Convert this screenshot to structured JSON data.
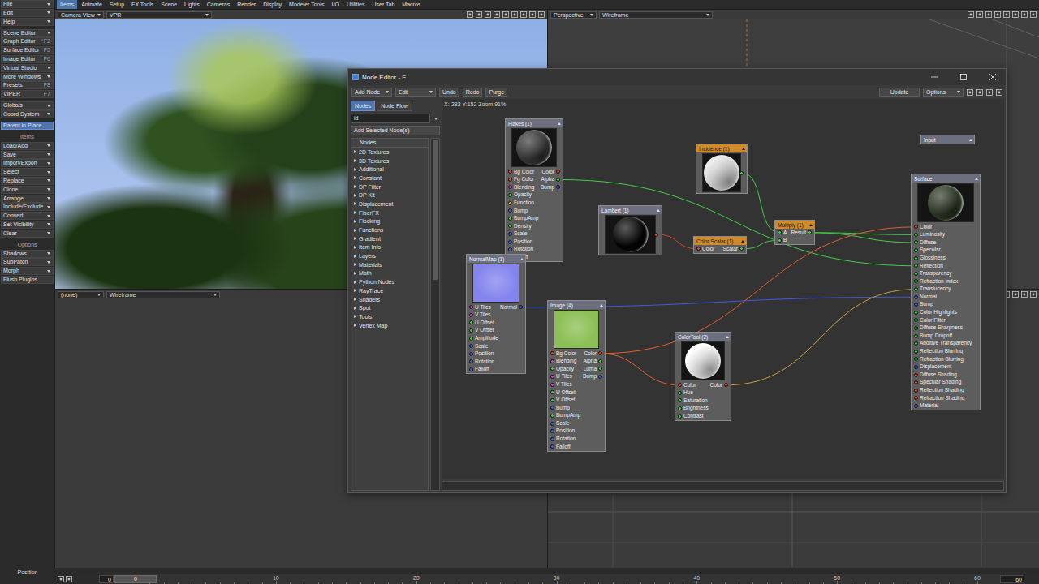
{
  "menu_tabs": [
    {
      "label": "Items",
      "selected": true
    },
    {
      "label": "Animate",
      "selected": false
    },
    {
      "label": "Setup",
      "selected": false
    },
    {
      "label": "FX Tools",
      "selected": false
    },
    {
      "label": "Scene",
      "selected": false
    },
    {
      "label": "Lights",
      "selected": false
    },
    {
      "label": "Cameras",
      "selected": false
    },
    {
      "label": "Render",
      "selected": false
    },
    {
      "label": "Display",
      "selected": false
    },
    {
      "label": "Modeler Tools",
      "selected": false
    },
    {
      "label": "I/O",
      "selected": false
    },
    {
      "label": "Utilities",
      "selected": false
    },
    {
      "label": "User Tab",
      "selected": false
    },
    {
      "label": "Macros",
      "selected": false
    }
  ],
  "sidebar": {
    "groups": [
      {
        "items": [
          {
            "label": "File",
            "dropdown": true
          },
          {
            "label": "Edit",
            "dropdown": true
          },
          {
            "label": "Help",
            "dropdown": true
          }
        ]
      },
      {
        "items": [
          {
            "label": "Scene Editor",
            "dropdown": true
          },
          {
            "label": "Graph Editor",
            "dropdown": false,
            "shortcut": "^F2"
          },
          {
            "label": "Surface Editor",
            "dropdown": false,
            "shortcut": "F5"
          },
          {
            "label": "Image Editor",
            "dropdown": false,
            "shortcut": "F6"
          },
          {
            "label": "Virtual Studio",
            "dropdown": true
          },
          {
            "label": "More Windows",
            "dropdown": true
          },
          {
            "label": "Presets",
            "dropdown": false,
            "shortcut": "F8"
          },
          {
            "label": "VIPER",
            "dropdown": false,
            "shortcut": "F7"
          }
        ]
      },
      {
        "items": [
          {
            "label": "Globals",
            "dropdown": true
          },
          {
            "label": "Coord System",
            "dropdown": true
          }
        ]
      },
      {
        "items": [
          {
            "label": "Parent in Place",
            "dropdown": false,
            "on": true
          }
        ]
      },
      {
        "header": "Items",
        "items": [
          {
            "label": "Load/Add",
            "dropdown": true
          },
          {
            "label": "Save",
            "dropdown": true
          },
          {
            "label": "Import/Export",
            "dropdown": true
          },
          {
            "label": "Select",
            "dropdown": true
          },
          {
            "label": "Replace",
            "dropdown": true
          },
          {
            "label": "Clone",
            "dropdown": true
          },
          {
            "label": "Arrange",
            "dropdown": true
          },
          {
            "label": "Include/Exclude",
            "dropdown": true
          },
          {
            "label": "Convert",
            "dropdown": true
          },
          {
            "label": "Set Visibility",
            "dropdown": true
          },
          {
            "label": "Clear",
            "dropdown": true
          }
        ]
      },
      {
        "header": "Options",
        "items": [
          {
            "label": "Shadows",
            "dropdown": true
          },
          {
            "label": "SubPatch",
            "dropdown": true
          },
          {
            "label": "Morph",
            "dropdown": true
          },
          {
            "label": "Flush Plugins",
            "dropdown": false
          }
        ]
      }
    ]
  },
  "viewports": [
    {
      "kind": "render",
      "view": "Camera View",
      "mode": "VPR"
    },
    {
      "kind": "grid",
      "view": "Perspective",
      "mode": "Wireframe"
    },
    {
      "kind": "empty",
      "view": "(none)",
      "mode": "Wireframe"
    },
    {
      "kind": "floor"
    }
  ],
  "timeline": {
    "label": "Position",
    "start": "0",
    "current": "0",
    "ticks": [
      "10",
      "20",
      "30",
      "40",
      "50",
      "60"
    ],
    "end": "60"
  },
  "node_editor": {
    "title": "Node Editor - F",
    "toolbar_left": [
      {
        "label": "Add Node",
        "dropdown": true
      },
      {
        "label": "Edit",
        "dropdown": true
      },
      {
        "label": "Undo",
        "dropdown": false
      },
      {
        "label": "Redo",
        "dropdown": false
      },
      {
        "label": "Purge",
        "dropdown": false
      }
    ],
    "toolbar_right": [
      {
        "label": "Update",
        "dropdown": false
      },
      {
        "label": "Options",
        "dropdown": true
      }
    ],
    "panel_tabs": [
      {
        "label": "Nodes",
        "selected": true
      },
      {
        "label": "Node Flow",
        "selected": false
      }
    ],
    "search": {
      "value": "id"
    },
    "add_button": "Add Selected Node(s)",
    "list_header": "Nodes",
    "categories": [
      {
        "label": "2D Textures",
        "expanded": false
      },
      {
        "label": "3D Textures",
        "expanded": false
      },
      {
        "label": "Additional",
        "expanded": false
      },
      {
        "label": "Constant",
        "expanded": false
      },
      {
        "label": "DP Filter",
        "expanded": false
      },
      {
        "label": "DP Kit",
        "expanded": false
      },
      {
        "label": "Displacement",
        "expanded": false
      },
      {
        "label": "FiberFX",
        "expanded": false
      },
      {
        "label": "Flocking",
        "expanded": false
      },
      {
        "label": "Functions",
        "expanded": false
      },
      {
        "label": "Gradient",
        "expanded": false
      },
      {
        "label": "Item Info",
        "expanded": false
      },
      {
        "label": "Layers",
        "expanded": false
      },
      {
        "label": "Materials",
        "expanded": false
      },
      {
        "label": "Math",
        "expanded": false
      },
      {
        "label": "Python Nodes",
        "expanded": false
      },
      {
        "label": "RayTrace",
        "expanded": false
      },
      {
        "label": "Shaders",
        "expanded": false
      },
      {
        "label": "Spot",
        "expanded": false
      },
      {
        "label": "Tools",
        "expanded": false
      },
      {
        "label": "Vertex Map",
        "expanded": false
      }
    ],
    "status": "X:-282 Y:152 Zoom:91%",
    "nodes": [
      {
        "title": "Flakes (1)",
        "selected": false,
        "preview": {
          "shape": "sphere",
          "color": "#3a3a3a"
        },
        "inputs": [
          {
            "label": "Bg Color",
            "color": "#e0482a"
          },
          {
            "label": "Fg Color",
            "color": "#e0482a"
          },
          {
            "label": "Blending",
            "color": "#c84ac8"
          },
          {
            "label": "Opacity",
            "color": "#3fcf45"
          },
          {
            "label": "Function",
            "color": "#d8c030"
          },
          {
            "label": "Bump",
            "color": "#4060e0"
          },
          {
            "label": "BumpAmp",
            "color": "#3fcf45"
          },
          {
            "label": "Density",
            "color": "#3fcf45"
          },
          {
            "label": "Scale",
            "color": "#4060e0"
          },
          {
            "label": "Position",
            "color": "#4060e0"
          },
          {
            "label": "Rotation",
            "color": "#4060e0"
          },
          {
            "label": "Falloff",
            "color": "#4060e0"
          }
        ],
        "outputs": [
          {
            "label": "Color",
            "color": "#e0482a"
          },
          {
            "label": "Alpha",
            "color": "#3fcf45"
          },
          {
            "label": "Bump",
            "color": "#4060e0"
          }
        ]
      },
      {
        "title": "Incidence (1)",
        "selected": true,
        "preview": {
          "shape": "sphere",
          "color": "#e6e6e6"
        },
        "inputs": [],
        "outputs": [],
        "out_pin": "#3fcf45"
      },
      {
        "title": "Lambert (1)",
        "selected": false,
        "preview": {
          "shape": "sphere",
          "color": "#050505"
        },
        "inputs": [],
        "outputs": [],
        "out_pin": "#e0482a"
      },
      {
        "title": "Color Scalar (1)",
        "selected": true,
        "inputs": [
          {
            "label": "Color",
            "color": "#e0482a"
          }
        ],
        "outputs": [
          {
            "label": "Scalar",
            "color": "#3fcf45"
          }
        ]
      },
      {
        "title": "Multiply (1)",
        "selected": true,
        "inputs": [
          {
            "label": "A",
            "color": "#3fcf45"
          },
          {
            "label": "B",
            "color": "#3fcf45"
          }
        ],
        "outputs": [
          {
            "label": "Result",
            "color": "#3fcf45"
          }
        ]
      },
      {
        "title": "NormalMap (1)",
        "selected": false,
        "preview": {
          "shape": "square",
          "color": "#8484ee"
        },
        "inputs": [
          {
            "label": "U Tiles",
            "color": "#c84ac8"
          },
          {
            "label": "V Tiles",
            "color": "#c84ac8"
          },
          {
            "label": "U Offset",
            "color": "#3fcf45"
          },
          {
            "label": "V Offset",
            "color": "#3fcf45"
          },
          {
            "label": "Amplitude",
            "color": "#3fcf45"
          },
          {
            "label": "Scale",
            "color": "#4060e0"
          },
          {
            "label": "Position",
            "color": "#4060e0"
          },
          {
            "label": "Rotation",
            "color": "#4060e0"
          },
          {
            "label": "Falloff",
            "color": "#4060e0"
          }
        ],
        "outputs": [
          {
            "label": "Normal",
            "color": "#4060e0"
          }
        ]
      },
      {
        "title": "Image (4)",
        "selected": false,
        "preview": {
          "shape": "square",
          "color": "#8cbf55"
        },
        "inputs": [
          {
            "label": "Bg Color",
            "color": "#e0482a"
          },
          {
            "label": "Blending",
            "color": "#c84ac8"
          },
          {
            "label": "Opacity",
            "color": "#3fcf45"
          },
          {
            "label": "U Tiles",
            "color": "#c84ac8"
          },
          {
            "label": "V Tiles",
            "color": "#c84ac8"
          },
          {
            "label": "U Offset",
            "color": "#3fcf45"
          },
          {
            "label": "V Offset",
            "color": "#3fcf45"
          },
          {
            "label": "Bump",
            "color": "#4060e0"
          },
          {
            "label": "BumpAmp",
            "color": "#3fcf45"
          },
          {
            "label": "Scale",
            "color": "#4060e0"
          },
          {
            "label": "Position",
            "color": "#4060e0"
          },
          {
            "label": "Rotation",
            "color": "#4060e0"
          },
          {
            "label": "Falloff",
            "color": "#4060e0"
          }
        ],
        "outputs": [
          {
            "label": "Color",
            "color": "#e0482a"
          },
          {
            "label": "Alpha",
            "color": "#3fcf45"
          },
          {
            "label": "Luma",
            "color": "#3fcf45"
          },
          {
            "label": "Bump",
            "color": "#4060e0"
          }
        ]
      },
      {
        "title": "ColorTool (2)",
        "selected": false,
        "preview": {
          "shape": "sphere",
          "color": "#ffffff"
        },
        "inputs": [
          {
            "label": "Color",
            "color": "#e0482a"
          },
          {
            "label": "Hue",
            "color": "#3fcf45"
          },
          {
            "label": "Saturation",
            "color": "#3fcf45"
          },
          {
            "label": "Brightness",
            "color": "#3fcf45"
          },
          {
            "label": "Contrast",
            "color": "#3fcf45"
          }
        ],
        "outputs": [
          {
            "label": "Color",
            "color": "#e0482a"
          }
        ]
      },
      {
        "title": "Surface",
        "selected": false,
        "preview": {
          "shape": "sphere",
          "color": "#2e3b26"
        },
        "inputs": [
          {
            "label": "Color",
            "color": "#e0482a"
          },
          {
            "label": "Luminosity",
            "color": "#3fcf45"
          },
          {
            "label": "Diffuse",
            "color": "#3fcf45"
          },
          {
            "label": "Specular",
            "color": "#3fcf45"
          },
          {
            "label": "Glossiness",
            "color": "#3fcf45"
          },
          {
            "label": "Reflection",
            "color": "#3fcf45"
          },
          {
            "label": "Transparency",
            "color": "#3fcf45"
          },
          {
            "label": "Refraction Index",
            "color": "#3fcf45"
          },
          {
            "label": "Translucency",
            "color": "#3fcf45"
          },
          {
            "label": "Normal",
            "color": "#4060e0"
          },
          {
            "label": "Bump",
            "color": "#4060e0"
          },
          {
            "label": "Color Highlights",
            "color": "#3fcf45"
          },
          {
            "label": "Color Filter",
            "color": "#3fcf45"
          },
          {
            "label": "Diffuse Sharpness",
            "color": "#3fcf45"
          },
          {
            "label": "Bump Dropoff",
            "color": "#3fcf45"
          },
          {
            "label": "Additive Transparency",
            "color": "#3fcf45"
          },
          {
            "label": "Reflection Blurring",
            "color": "#3fcf45"
          },
          {
            "label": "Refraction Blurring",
            "color": "#3fcf45"
          },
          {
            "label": "Displacement",
            "color": "#4060e0"
          },
          {
            "label": "Diffuse Shading",
            "color": "#e0482a"
          },
          {
            "label": "Specular Shading",
            "color": "#e0482a"
          },
          {
            "label": "Reflection Shading",
            "color": "#e0482a"
          },
          {
            "label": "Refraction Shading",
            "color": "#e0482a"
          },
          {
            "label": "Material",
            "color": "#9070e0"
          }
        ],
        "outputs": []
      },
      {
        "title": "Input",
        "selected": false,
        "inputs": [],
        "outputs": []
      }
    ],
    "connections": [
      {
        "from": "Flakes (1)",
        "output": "Alpha",
        "to": "Surface",
        "input": "Reflection",
        "color": "#3fcf45"
      },
      {
        "from": "Incidence (1)",
        "to": "Multiply (1)",
        "input": "A",
        "color": "#3fcf45"
      },
      {
        "from": "Lambert (1)",
        "to": "Color Scalar (1)",
        "input": "Color",
        "color": "#d8452a"
      },
      {
        "from": "Color Scalar (1)",
        "output": "Scalar",
        "to": "Multiply (1)",
        "input": "B",
        "color": "#3fcf45"
      },
      {
        "from": "Multiply (1)",
        "output": "Result",
        "to": "Surface",
        "input": "Luminosity",
        "color": "#3fcf45"
      },
      {
        "from": "Multiply (1)",
        "output": "Result",
        "to": "Surface",
        "input": "Diffuse",
        "color": "#3fcf45"
      },
      {
        "from": "NormalMap (1)",
        "output": "Normal",
        "to": "Surface",
        "input": "Normal",
        "color": "#4058e0"
      },
      {
        "from": "Image (4)",
        "output": "Color",
        "to": "Surface",
        "input": "Color",
        "color": "#e0602a"
      },
      {
        "from": "Image (4)",
        "output": "Color",
        "to": "ColorTool (2)",
        "input": "Color",
        "color": "#e0602a"
      },
      {
        "from": "ColorTool (2)",
        "output": "Color",
        "to": "Surface",
        "input": "Translucency",
        "color": "#c8a040"
      }
    ]
  }
}
